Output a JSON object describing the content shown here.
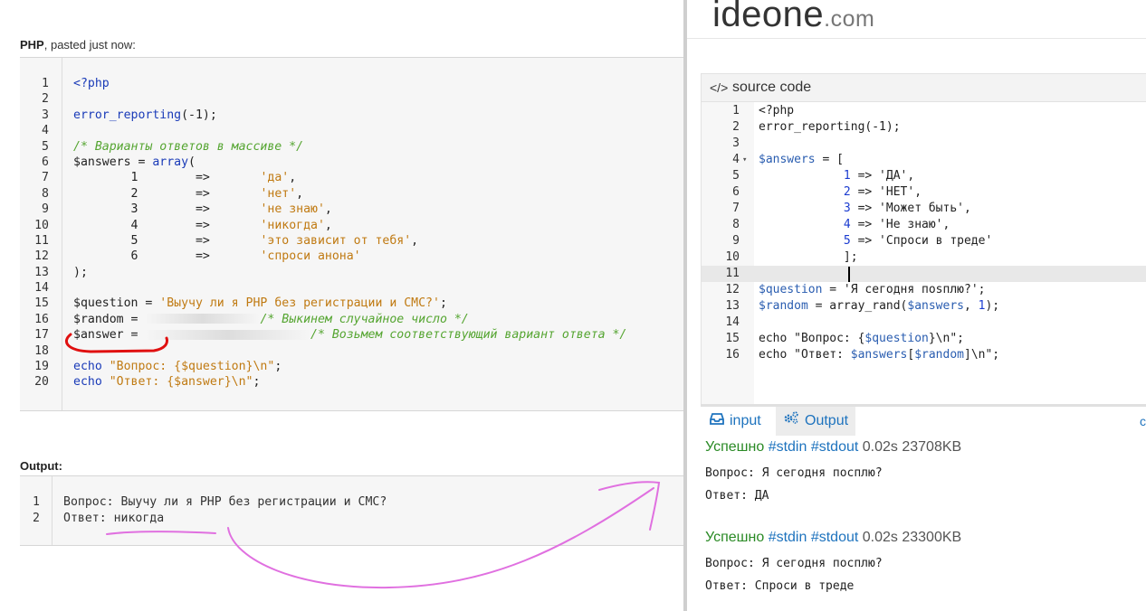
{
  "paste": {
    "lang": "PHP",
    "suffix": ", pasted just now:",
    "code": [
      {
        "n": "1",
        "parts": [
          {
            "c": "kw",
            "t": "<?php"
          }
        ]
      },
      {
        "n": "2",
        "parts": []
      },
      {
        "n": "3",
        "parts": [
          {
            "c": "kw",
            "t": "error_reporting"
          },
          {
            "c": "var",
            "t": "(-1);"
          }
        ]
      },
      {
        "n": "4",
        "parts": []
      },
      {
        "n": "5",
        "parts": [
          {
            "c": "cmt",
            "t": "/* Варианты ответов в массиве */"
          }
        ]
      },
      {
        "n": "6",
        "parts": [
          {
            "c": "var",
            "t": "$answers = "
          },
          {
            "c": "kw",
            "t": "array"
          },
          {
            "c": "var",
            "t": "("
          }
        ]
      },
      {
        "n": "7",
        "parts": [
          {
            "c": "var",
            "t": "        1        =>       "
          },
          {
            "c": "str",
            "t": "'да'"
          },
          {
            "c": "var",
            "t": ","
          }
        ]
      },
      {
        "n": "8",
        "parts": [
          {
            "c": "var",
            "t": "        2        =>       "
          },
          {
            "c": "str",
            "t": "'нет'"
          },
          {
            "c": "var",
            "t": ","
          }
        ]
      },
      {
        "n": "9",
        "parts": [
          {
            "c": "var",
            "t": "        3        =>       "
          },
          {
            "c": "str",
            "t": "'не знаю'"
          },
          {
            "c": "var",
            "t": ","
          }
        ]
      },
      {
        "n": "10",
        "parts": [
          {
            "c": "var",
            "t": "        4        =>       "
          },
          {
            "c": "str",
            "t": "'никогда'"
          },
          {
            "c": "var",
            "t": ","
          }
        ]
      },
      {
        "n": "11",
        "parts": [
          {
            "c": "var",
            "t": "        5        =>       "
          },
          {
            "c": "str",
            "t": "'это зависит от тебя'"
          },
          {
            "c": "var",
            "t": ","
          }
        ]
      },
      {
        "n": "12",
        "parts": [
          {
            "c": "var",
            "t": "        6        =>       "
          },
          {
            "c": "str",
            "t": "'спроси анона'"
          }
        ]
      },
      {
        "n": "13",
        "parts": [
          {
            "c": "var",
            "t": ");"
          }
        ]
      },
      {
        "n": "14",
        "parts": []
      },
      {
        "n": "15",
        "parts": [
          {
            "c": "var",
            "t": "$question = "
          },
          {
            "c": "str",
            "t": "'Выучу ли я PHP без регистрации и СМС?'"
          },
          {
            "c": "var",
            "t": ";"
          }
        ]
      },
      {
        "n": "16",
        "parts": [
          {
            "c": "var",
            "t": "$random = "
          },
          {
            "c": "blur",
            "t": "                "
          },
          {
            "c": "cmt",
            "t": "/* Выкинем случайное число */"
          }
        ]
      },
      {
        "n": "17",
        "parts": [
          {
            "c": "var",
            "t": "$answer = "
          },
          {
            "c": "blur",
            "t": "                       "
          },
          {
            "c": "cmt",
            "t": "/* Возьмем соответствующий вариант ответа */"
          }
        ]
      },
      {
        "n": "18",
        "parts": []
      },
      {
        "n": "19",
        "parts": [
          {
            "c": "kw",
            "t": "echo"
          },
          {
            "c": "str",
            "t": " \"Вопрос: {$question}\\n\""
          },
          {
            "c": "var",
            "t": ";"
          }
        ]
      },
      {
        "n": "20",
        "parts": [
          {
            "c": "kw",
            "t": "echo"
          },
          {
            "c": "str",
            "t": " \"Ответ: {$answer}\\n\""
          },
          {
            "c": "var",
            "t": ";"
          }
        ]
      }
    ],
    "output_label": "Output:",
    "output": [
      {
        "n": "1",
        "t": "Вопрос: Выучу ли я PHP без регистрации и СМС?"
      },
      {
        "n": "2",
        "t": "Ответ: никогда"
      }
    ]
  },
  "ideone": {
    "logo_main": "ideone",
    "logo_domain": ".com",
    "source_icon": "code-icon",
    "source_title": "source code",
    "code": [
      {
        "n": "1",
        "fold": "",
        "parts": [
          {
            "c": "",
            "t": "<?php"
          }
        ]
      },
      {
        "n": "2",
        "fold": "",
        "parts": [
          {
            "c": "",
            "t": "error_reporting(-1);"
          }
        ]
      },
      {
        "n": "3",
        "fold": "",
        "parts": []
      },
      {
        "n": "4",
        "fold": "▾",
        "parts": [
          {
            "c": "sv",
            "t": "$answers"
          },
          {
            "c": "",
            "t": " = ["
          }
        ]
      },
      {
        "n": "5",
        "fold": "",
        "parts": [
          {
            "c": "",
            "t": "            "
          },
          {
            "c": "sn",
            "t": "1"
          },
          {
            "c": "",
            "t": " => 'ДА',"
          }
        ]
      },
      {
        "n": "6",
        "fold": "",
        "parts": [
          {
            "c": "",
            "t": "            "
          },
          {
            "c": "sn",
            "t": "2"
          },
          {
            "c": "",
            "t": " => 'НЕТ',"
          }
        ]
      },
      {
        "n": "7",
        "fold": "",
        "parts": [
          {
            "c": "",
            "t": "            "
          },
          {
            "c": "sn",
            "t": "3"
          },
          {
            "c": "",
            "t": " => 'Может быть',"
          }
        ]
      },
      {
        "n": "8",
        "fold": "",
        "parts": [
          {
            "c": "",
            "t": "            "
          },
          {
            "c": "sn",
            "t": "4"
          },
          {
            "c": "",
            "t": " => 'Не знаю',"
          }
        ]
      },
      {
        "n": "9",
        "fold": "",
        "parts": [
          {
            "c": "",
            "t": "            "
          },
          {
            "c": "sn",
            "t": "5"
          },
          {
            "c": "",
            "t": " => 'Спроси в треде'"
          }
        ]
      },
      {
        "n": "10",
        "fold": "",
        "parts": [
          {
            "c": "",
            "t": "            ];"
          }
        ]
      },
      {
        "n": "11",
        "fold": "",
        "active": true,
        "parts": []
      },
      {
        "n": "12",
        "fold": "",
        "parts": [
          {
            "c": "sv",
            "t": "$question"
          },
          {
            "c": "",
            "t": " = 'Я сегодня пosплю?';"
          }
        ]
      },
      {
        "n": "13",
        "fold": "",
        "parts": [
          {
            "c": "sv",
            "t": "$random"
          },
          {
            "c": "",
            "t": " = array_rand("
          },
          {
            "c": "sv",
            "t": "$answers"
          },
          {
            "c": "",
            "t": ", "
          },
          {
            "c": "sn",
            "t": "1"
          },
          {
            "c": "",
            "t": ");"
          }
        ]
      },
      {
        "n": "14",
        "fold": "",
        "parts": []
      },
      {
        "n": "15",
        "fold": "",
        "parts": [
          {
            "c": "",
            "t": "echo \"Вопрос: {"
          },
          {
            "c": "sv",
            "t": "$question"
          },
          {
            "c": "",
            "t": "}\\n\";"
          }
        ]
      },
      {
        "n": "16",
        "fold": "",
        "parts": [
          {
            "c": "",
            "t": "echo \"Ответ: "
          },
          {
            "c": "sv",
            "t": "$answers"
          },
          {
            "c": "",
            "t": "["
          },
          {
            "c": "sv",
            "t": "$random"
          },
          {
            "c": "",
            "t": "]\\n\";"
          }
        ]
      }
    ],
    "tabs": {
      "input_label": "input",
      "output_label": "Output",
      "right_glyph": "c"
    },
    "results": [
      {
        "status": "Успешно",
        "tags": "#stdin #stdout",
        "meta": "0.02s 23708KB",
        "lines": [
          "Вопрос: Я сегодня посплю?",
          "Ответ: ДА"
        ]
      },
      {
        "status": "Успешно",
        "tags": "#stdin #stdout",
        "meta": "0.02s 23300KB",
        "lines": [
          "Вопрос: Я сегодня посплю?",
          "Ответ: Спроси в треде"
        ]
      }
    ]
  }
}
